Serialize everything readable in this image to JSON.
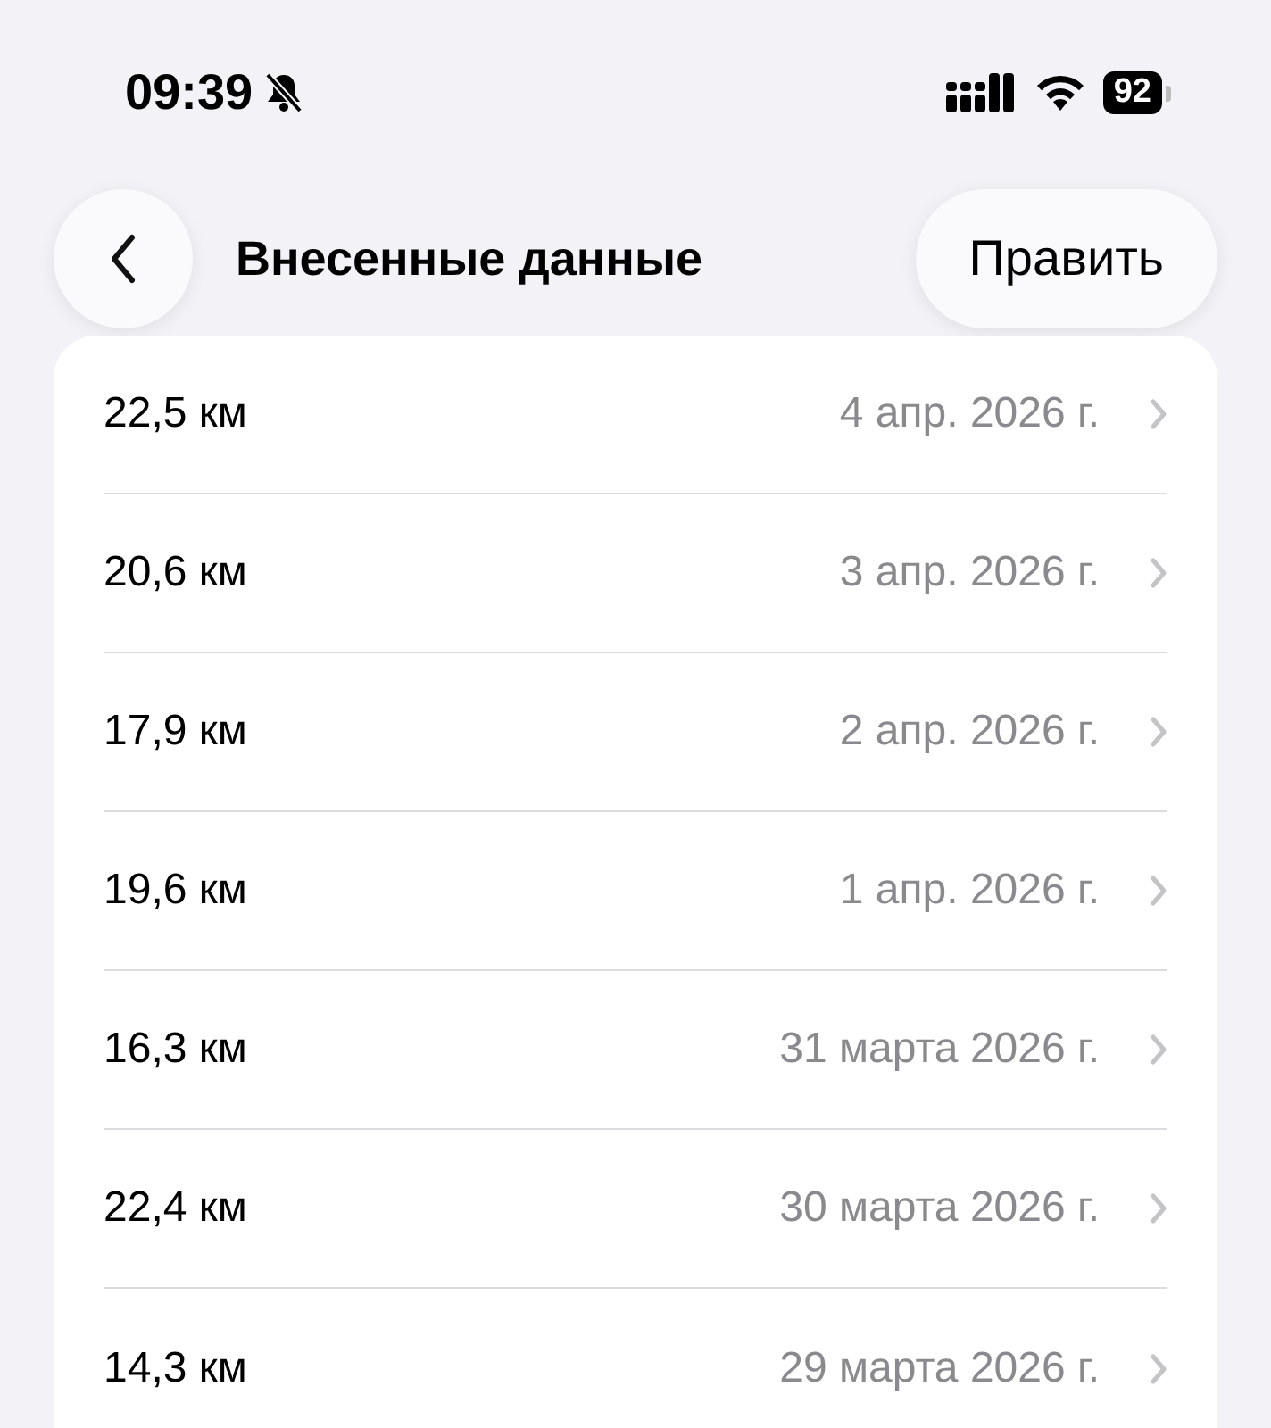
{
  "status_bar": {
    "time": "09:39",
    "silent": true,
    "battery": "92"
  },
  "header": {
    "title": "Внесенные данные",
    "edit_button": "Править"
  },
  "rows": [
    {
      "value": "22,5 км",
      "date": "4 апр. 2026 г."
    },
    {
      "value": "20,6 км",
      "date": "3 апр. 2026 г."
    },
    {
      "value": "17,9 км",
      "date": "2 апр. 2026 г."
    },
    {
      "value": "19,6 км",
      "date": "1 апр. 2026 г."
    },
    {
      "value": "16,3 км",
      "date": "31 марта 2026 г."
    },
    {
      "value": "22,4 км",
      "date": "30 марта 2026 г."
    },
    {
      "value": "14,3 км",
      "date": "29 марта 2026 г."
    }
  ]
}
